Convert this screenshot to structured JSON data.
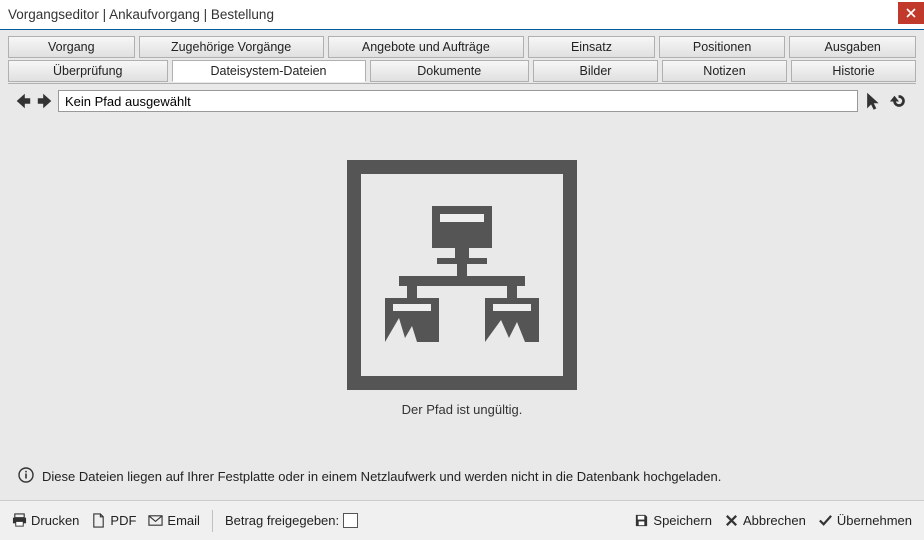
{
  "window": {
    "title": "Vorgangseditor | Ankaufvorgang | Bestellung"
  },
  "tabs_row1": [
    {
      "label": "Vorgang"
    },
    {
      "label": "Zugehörige Vorgänge"
    },
    {
      "label": "Angebote und Aufträge"
    },
    {
      "label": "Einsatz"
    },
    {
      "label": "Positionen"
    },
    {
      "label": "Ausgaben"
    }
  ],
  "tabs_row2": [
    {
      "label": "Überprüfung"
    },
    {
      "label": "Dateisystem-Dateien",
      "active": true
    },
    {
      "label": "Dokumente"
    },
    {
      "label": "Bilder"
    },
    {
      "label": "Notizen"
    },
    {
      "label": "Historie"
    }
  ],
  "filesystem": {
    "path_value": "Kein Pfad ausgewählt",
    "invalid_msg": "Der Pfad ist ungültig."
  },
  "info": {
    "text": "Diese Dateien liegen auf Ihrer Festplatte oder in einem Netzlaufwerk und werden nicht in die Datenbank hochgeladen."
  },
  "footer": {
    "print": "Drucken",
    "pdf": "PDF",
    "email": "Email",
    "release_label": "Betrag freigegeben:",
    "save": "Speichern",
    "cancel": "Abbrechen",
    "apply": "Übernehmen"
  }
}
